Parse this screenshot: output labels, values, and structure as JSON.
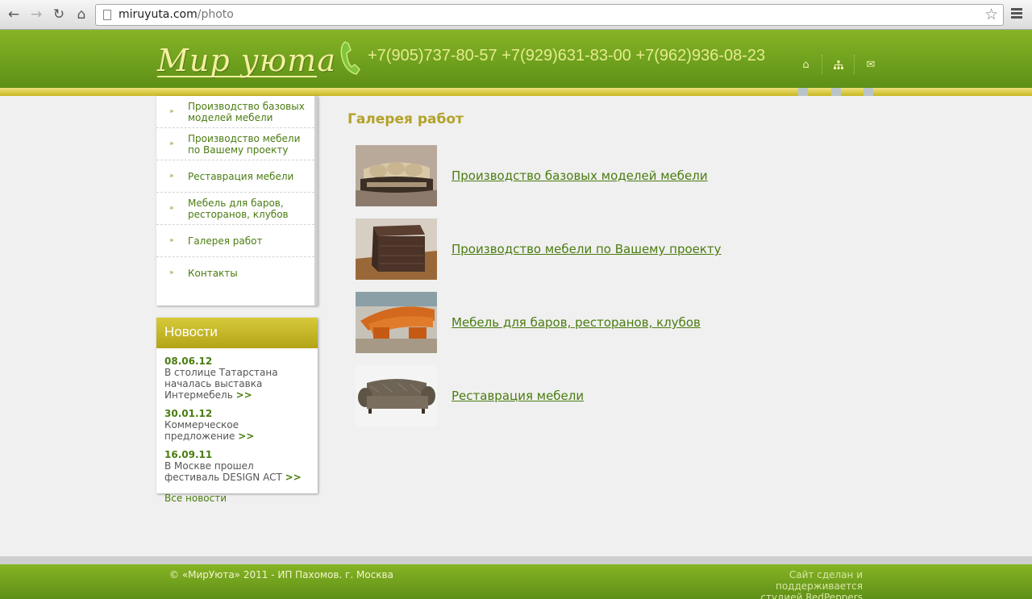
{
  "browser": {
    "url_host": "miruyuta.com",
    "url_path": "/photo"
  },
  "header": {
    "logo": "Мир уюта",
    "phones": "+7(905)737-80-57 +7(929)631-83-00 +7(962)936-08-23"
  },
  "menu": {
    "items": [
      {
        "label": "Производство базовых моделей мебели"
      },
      {
        "label": "Производство мебели по Вашему проекту"
      },
      {
        "label": "Реставрация мебели"
      },
      {
        "label": "Мебель для баров, ресторанов, клубов"
      },
      {
        "label": "Галерея работ"
      },
      {
        "label": "Контакты"
      }
    ]
  },
  "news": {
    "title": "Новости",
    "items": [
      {
        "date": "08.06.12",
        "text": "В столице Татарстана началась выставка Интермебель",
        "more": ">>"
      },
      {
        "date": "30.01.12",
        "text": "Коммерческое предложение",
        "more": ">>"
      },
      {
        "date": "16.09.11",
        "text": "В Москве прошел фестиваль DESIGN ACT",
        "more": ">>"
      }
    ],
    "all_link": "Все новости"
  },
  "main": {
    "title": "Галерея работ",
    "gallery": [
      {
        "label": "Производство базовых моделей мебели"
      },
      {
        "label": "Производство мебели по Вашему проекту"
      },
      {
        "label": "Мебель для баров, ресторанов, клубов"
      },
      {
        "label": "Реставрация мебели"
      }
    ]
  },
  "footer": {
    "copyright": "© «МирУюта» 2011 - ИП Пахомов. г. Москва",
    "credit_line1": "Сайт сделан и поддерживается",
    "credit_line2": "студией RedPeppers"
  },
  "colors": {
    "header_green": "#6fa11e",
    "link_green": "#4a7c10",
    "gold_title": "#b3a22a"
  }
}
